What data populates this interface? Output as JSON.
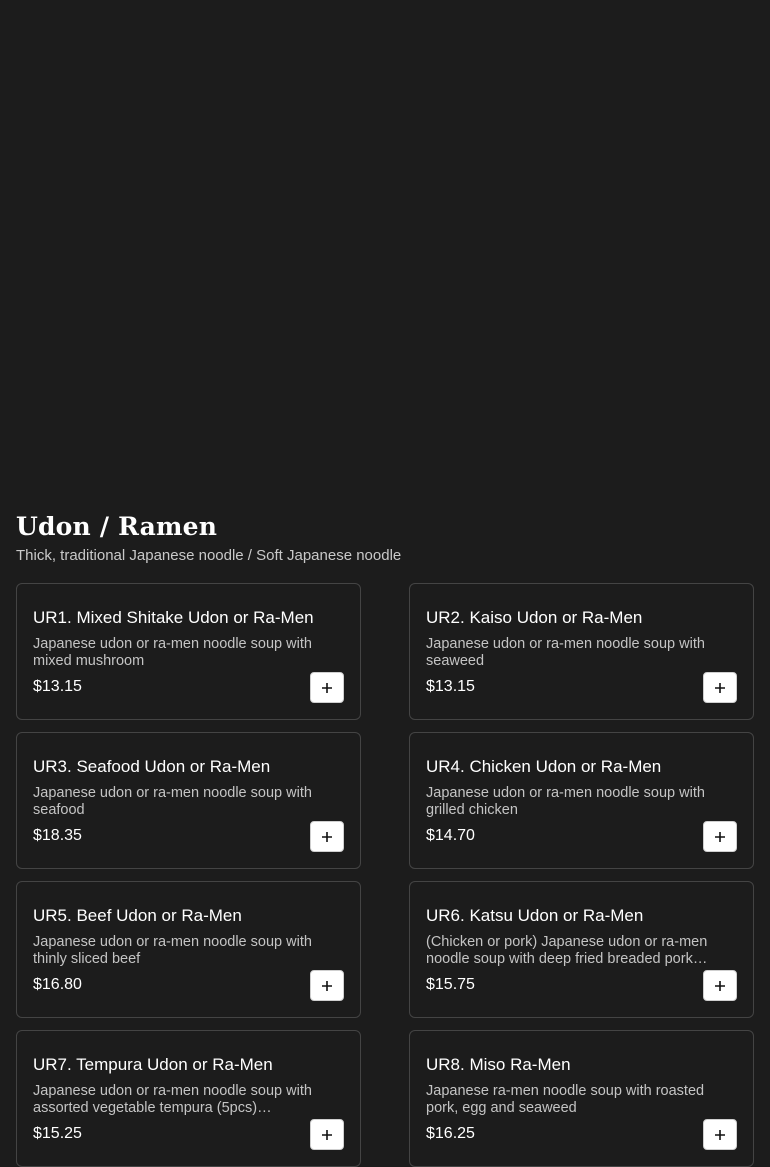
{
  "section": {
    "title": "Udon / Ramen",
    "subtitle": "Thick, traditional Japanese noodle / Soft Japanese noodle"
  },
  "items": [
    {
      "name": "UR1. Mixed Shitake Udon or Ra-Men",
      "description": "Japanese udon or ra-men noodle soup with mixed mushroom",
      "price": "$13.15",
      "add_icon": "plus-icon"
    },
    {
      "name": "UR2. Kaiso Udon or Ra-Men",
      "description": "Japanese udon or ra-men noodle soup with seaweed",
      "price": "$13.15",
      "add_icon": "plus-icon"
    },
    {
      "name": "UR3. Seafood Udon or Ra-Men",
      "description": "Japanese udon or ra-men noodle soup with seafood",
      "price": "$18.35",
      "add_icon": "plus-icon"
    },
    {
      "name": "UR4. Chicken Udon or Ra-Men",
      "description": "Japanese udon or ra-men noodle soup with grilled chicken",
      "price": "$14.70",
      "add_icon": "plus-icon"
    },
    {
      "name": "UR5. Beef Udon or Ra-Men",
      "description": "Japanese udon or ra-men noodle soup with thinly sliced beef",
      "price": "$16.80",
      "add_icon": "plus-icon"
    },
    {
      "name": "UR6. Katsu Udon or Ra-Men",
      "description": "(Chicken or pork) Japanese udon or ra-men noodle soup with deep fried breaded pork…",
      "price": "$15.75",
      "add_icon": "plus-icon"
    },
    {
      "name": "UR7. Tempura Udon or Ra-Men",
      "description": "Japanese udon or ra-men noodle soup with assorted vegetable tempura (5pcs)…",
      "price": "$15.25",
      "add_icon": "plus-icon"
    },
    {
      "name": "UR8. Miso Ra-Men",
      "description": "Japanese ra-men noodle soup with roasted pork, egg and seaweed",
      "price": "$16.25",
      "add_icon": "plus-icon"
    }
  ],
  "colors": {
    "background": "#1c1c1c",
    "card_border": "#444444",
    "button_bg": "#ffffff"
  }
}
